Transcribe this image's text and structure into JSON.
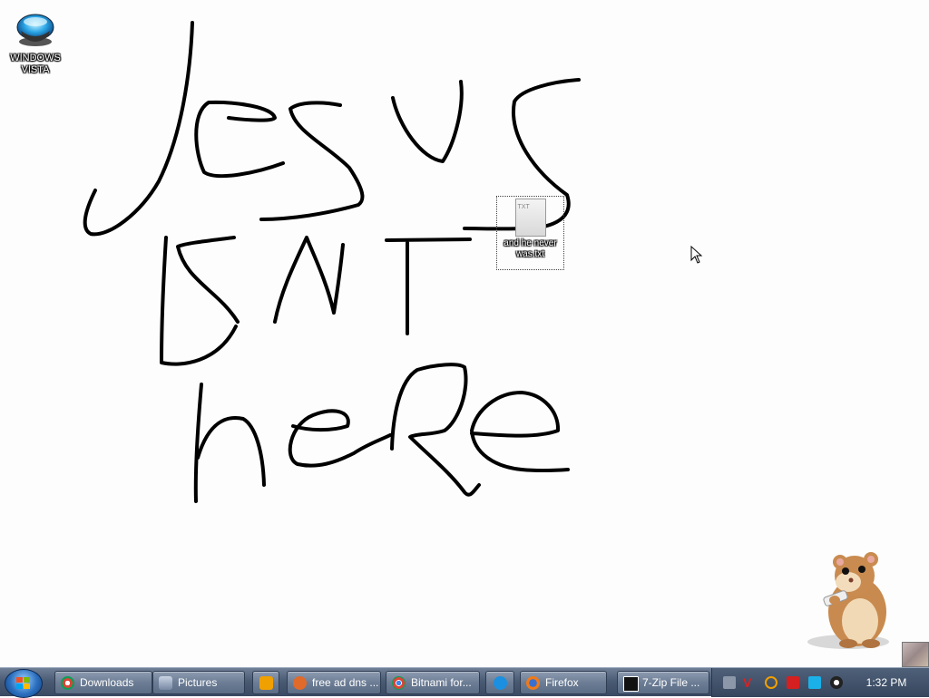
{
  "desktop": {
    "icons": [
      {
        "label": "WINDOWS VISTA"
      },
      {
        "label": "and he never was.txt",
        "badge": "TXT"
      }
    ],
    "drawing_text": "JESUS ISNT HERE"
  },
  "taskbar": {
    "items": [
      {
        "label": "Downloads",
        "icon": "chrome-download-icon"
      },
      {
        "label": "Pictures",
        "icon": "pictures-folder-icon"
      },
      {
        "label": "",
        "icon": "media-player-icon"
      },
      {
        "label": "free ad dns ...",
        "icon": "app-icon"
      },
      {
        "label": "Bitnami for...",
        "icon": "chrome-icon"
      },
      {
        "label": "",
        "icon": "internet-explorer-icon"
      },
      {
        "label": "Firefox",
        "icon": "firefox-icon"
      },
      {
        "label": "7-Zip File ...",
        "icon": "7zip-icon"
      }
    ],
    "clock": "1:32 PM"
  },
  "colors": {
    "taskbar": "#4a5b74",
    "ink": "#000000"
  }
}
